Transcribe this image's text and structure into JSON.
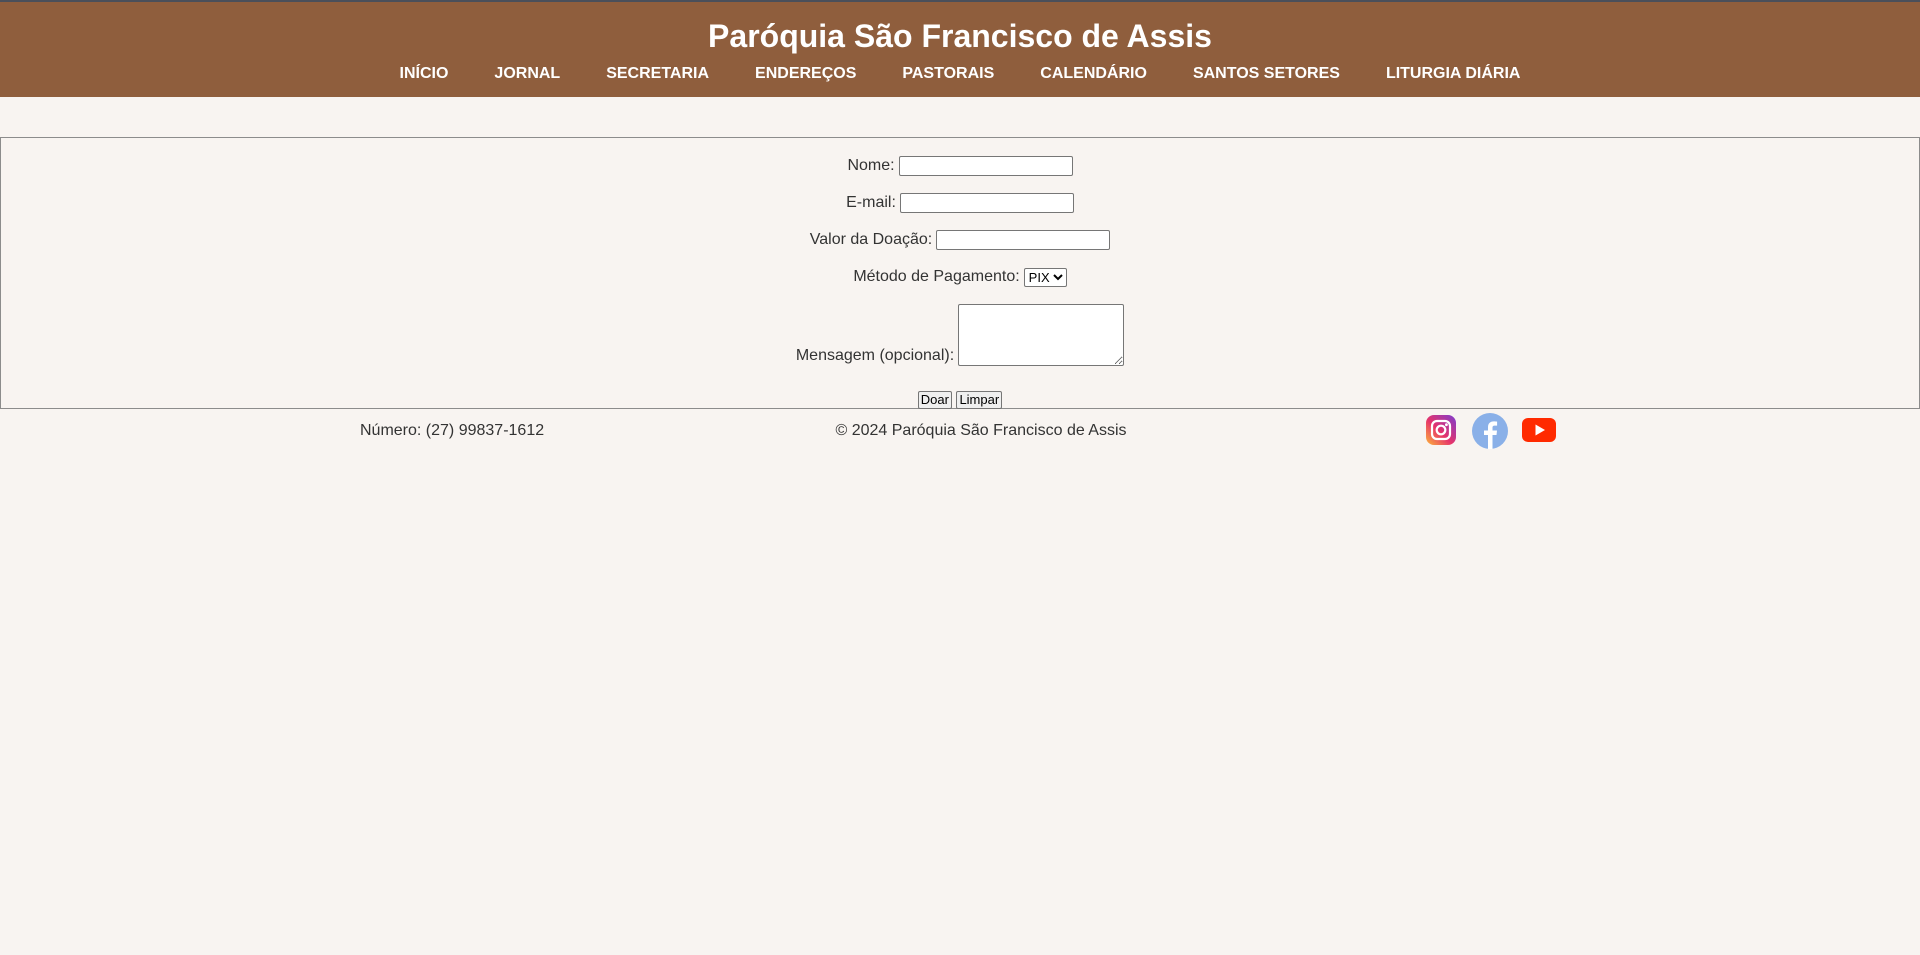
{
  "header": {
    "title": "Paróquia São Francisco de Assis",
    "nav": [
      {
        "label": "INÍCIO"
      },
      {
        "label": "JORNAL"
      },
      {
        "label": "SECRETARIA"
      },
      {
        "label": "ENDEREÇOS"
      },
      {
        "label": "PASTORAIS"
      },
      {
        "label": "CALENDÁRIO"
      },
      {
        "label": "SANTOS SETORES"
      },
      {
        "label": "LITURGIA DIÁRIA"
      }
    ]
  },
  "form": {
    "name_label": "Nome:",
    "name_value": "",
    "email_label": "E-mail:",
    "email_value": "",
    "amount_label": "Valor da Doação:",
    "amount_value": "",
    "payment_label": "Método de Pagamento:",
    "payment_selected": "PIX",
    "message_label": "Mensagem (opcional):",
    "submit_label": "Doar",
    "reset_label": "Limpar"
  },
  "footer": {
    "phone": "Número: (27) 99837-1612",
    "copyright": "© 2024 Paróquia São Francisco de Assis"
  },
  "social": [
    {
      "icon": "instagram-icon"
    },
    {
      "icon": "facebook-icon"
    },
    {
      "icon": "youtube-icon"
    }
  ],
  "colors": {
    "header_bg": "#8f5e3d",
    "page_bg": "#f8f4f1",
    "facebook_blue": "#8ab0e8",
    "youtube_red": "#ff2a00"
  }
}
